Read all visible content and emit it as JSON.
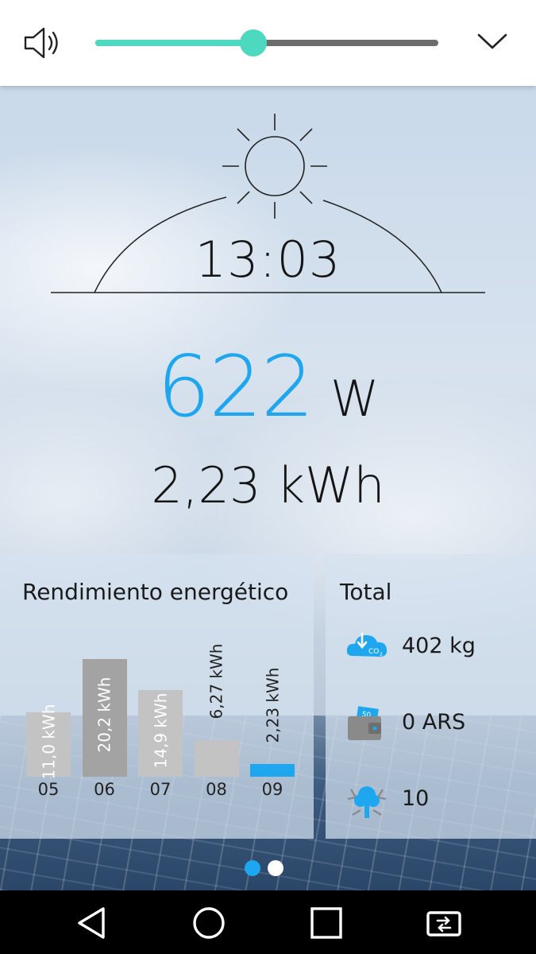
{
  "volume": {
    "level_percent": 46,
    "accent_color": "#4dd9bf",
    "speaker_icon": "speaker-icon",
    "collapse_icon": "chevron-down-icon"
  },
  "sun": {
    "icon": "sun-icon",
    "time": "13:03"
  },
  "power": {
    "value": "622",
    "unit": "W",
    "color": "#1ea7ef"
  },
  "energy_today": "2,23 kWh",
  "performance": {
    "title": "Rendimiento energético",
    "bars": [
      {
        "day": "05",
        "label": "11,0 kWh",
        "value": 11.0
      },
      {
        "day": "06",
        "label": "20,2 kWh",
        "value": 20.2
      },
      {
        "day": "07",
        "label": "14,9 kWh",
        "value": 14.9
      },
      {
        "day": "08",
        "label": "6,27 kWh",
        "value": 6.27
      },
      {
        "day": "09",
        "label": "2,23 kWh",
        "value": 2.23
      }
    ]
  },
  "total": {
    "title": "Total",
    "items": [
      {
        "icon": "co2-cloud-icon",
        "value": "402 kg"
      },
      {
        "icon": "wallet-icon",
        "value": "0 ARS"
      },
      {
        "icon": "tree-icon",
        "value": "10"
      }
    ]
  },
  "pager": {
    "pages": 2,
    "active": 0
  },
  "nav": {
    "back_icon": "back-icon",
    "home_icon": "home-icon",
    "recents_icon": "recents-icon",
    "switch_icon": "screen-switch-icon"
  }
}
